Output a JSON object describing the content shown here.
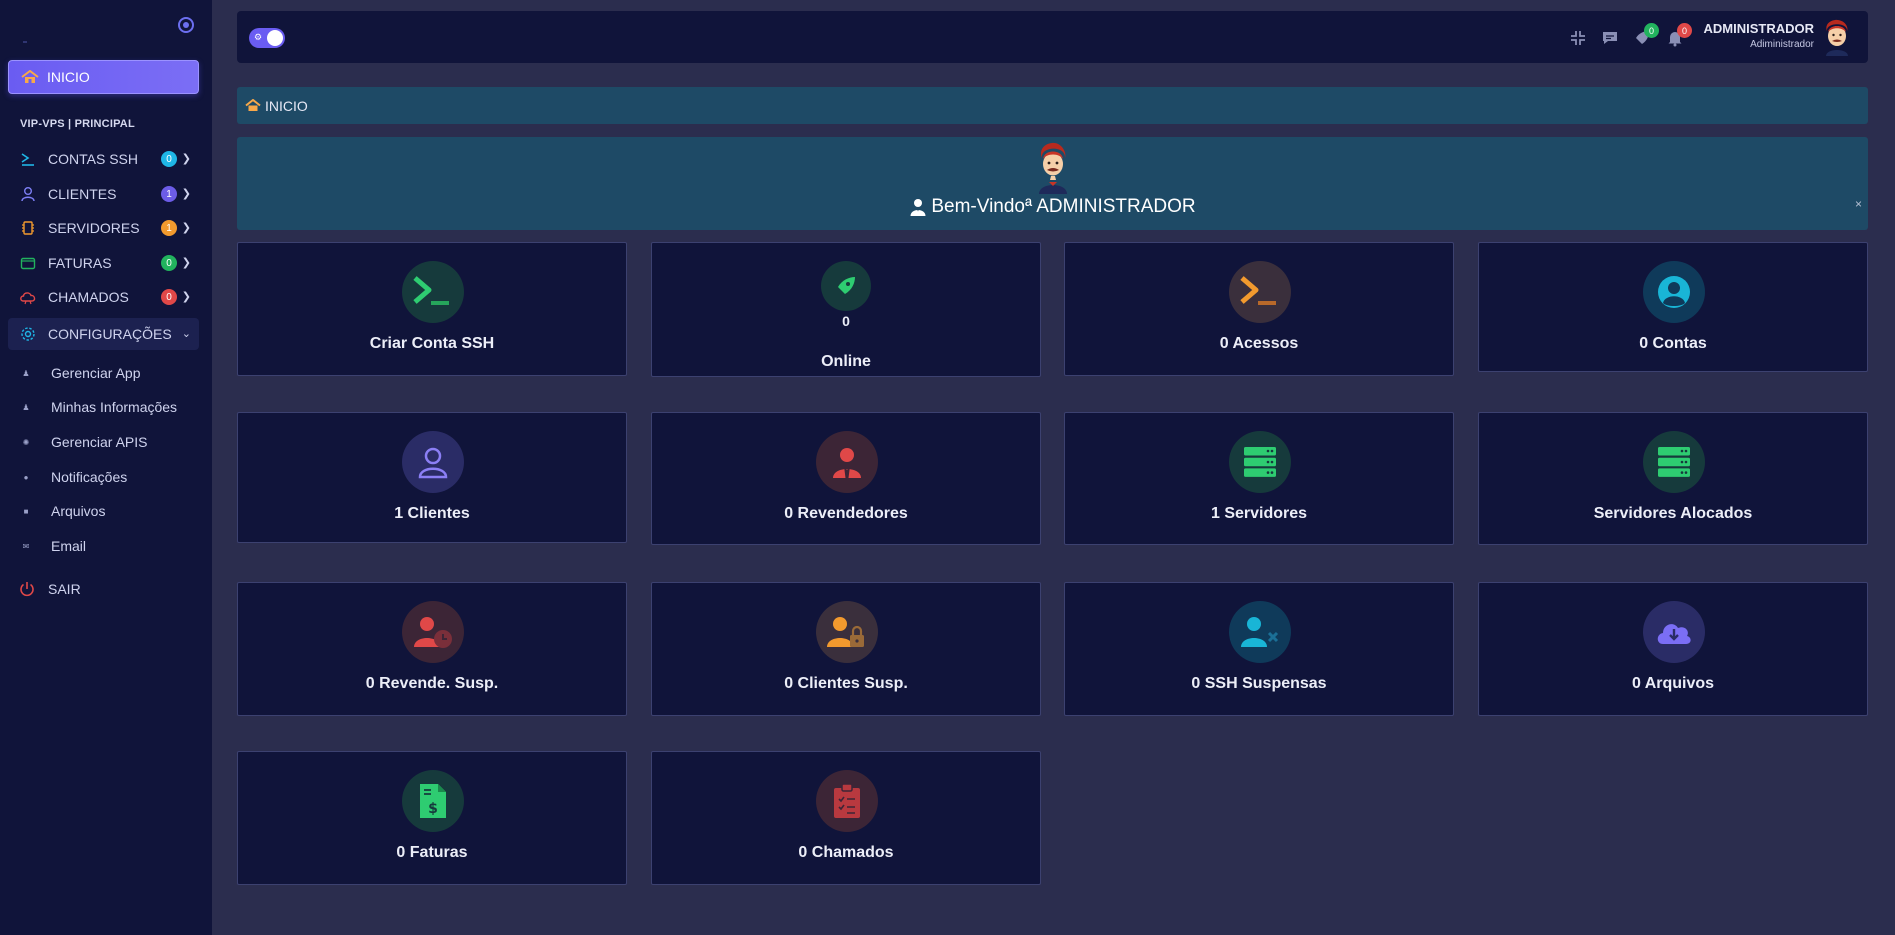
{
  "sidebar": {
    "home_label": "INICIO",
    "section_label": "VIP-VPS | PRINCIPAL",
    "items": [
      {
        "label": "CONTAS SSH",
        "badge": "0",
        "badge_color": "#1fb6e6"
      },
      {
        "label": "CLIENTES",
        "badge": "1",
        "badge_color": "#6c5ce7"
      },
      {
        "label": "SERVIDORES",
        "badge": "1",
        "badge_color": "#f29a2e"
      },
      {
        "label": "FATURAS",
        "badge": "0",
        "badge_color": "#22b35e"
      },
      {
        "label": "CHAMADOS",
        "badge": "0",
        "badge_color": "#e04848"
      }
    ],
    "config_label": "CONFIGURAÇÕES",
    "sub_items": [
      {
        "label": "Gerenciar App"
      },
      {
        "label": "Minhas Informações"
      },
      {
        "label": "Gerenciar APIS"
      },
      {
        "label": "Notificações"
      },
      {
        "label": "Arquivos"
      },
      {
        "label": "Email"
      }
    ],
    "logout_label": "SAIR"
  },
  "topbar": {
    "tickets_badge": "0",
    "notifications_badge": "0",
    "user_name": "ADMINISTRADOR",
    "user_role": "Adiministrador"
  },
  "breadcrumb": {
    "label": "INICIO"
  },
  "welcome": {
    "message": "Bem-Vindoª ADMINISTRADOR",
    "close": "×"
  },
  "cards": {
    "create_ssh": "Criar Conta SSH",
    "online_count": "0",
    "online_label": "Online",
    "access": "0 Acessos",
    "accounts": "0 Contas",
    "clients": "1 Clientes",
    "resellers": "0 Revendedores",
    "servers": "1 Servidores",
    "allocated_servers": "Servidores Alocados",
    "suspended_resellers": "0 Revende. Susp.",
    "suspended_clients": "0 Clientes Susp.",
    "suspended_ssh": "0 SSH Suspensas",
    "files": "0 Arquivos",
    "invoices": "0 Faturas",
    "tickets": "0 Chamados"
  },
  "colors": {
    "sidebar_bg": "#10143a",
    "page_bg": "#2b2d4e",
    "accent": "#6a5cf2",
    "banner_bg": "#1e4a66"
  }
}
